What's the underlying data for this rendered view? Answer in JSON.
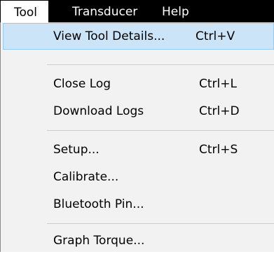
{
  "menubar": {
    "menus": [
      {
        "label": "Tool"
      },
      {
        "label": "Transducer"
      },
      {
        "label": "Help"
      }
    ]
  },
  "dropdown": {
    "items": [
      {
        "label": "View Tool Details...",
        "shortcut": "Ctrl+V",
        "highlighted": true
      },
      {
        "label": "Close Log",
        "shortcut": "Ctrl+L"
      },
      {
        "label": "Download Logs",
        "shortcut": "Ctrl+D"
      },
      {
        "label": "Setup...",
        "shortcut": "Ctrl+S"
      },
      {
        "label": "Calibrate...",
        "shortcut": ""
      },
      {
        "label": "Bluetooth Pin...",
        "shortcut": ""
      },
      {
        "label": "Graph Torque...",
        "shortcut": ""
      }
    ]
  },
  "colors": {
    "menubar_bg": "#000000",
    "dropdown_bg": "#f2f2f2",
    "highlight_bg": "#cce4f7",
    "highlight_border": "#99c9ef"
  }
}
